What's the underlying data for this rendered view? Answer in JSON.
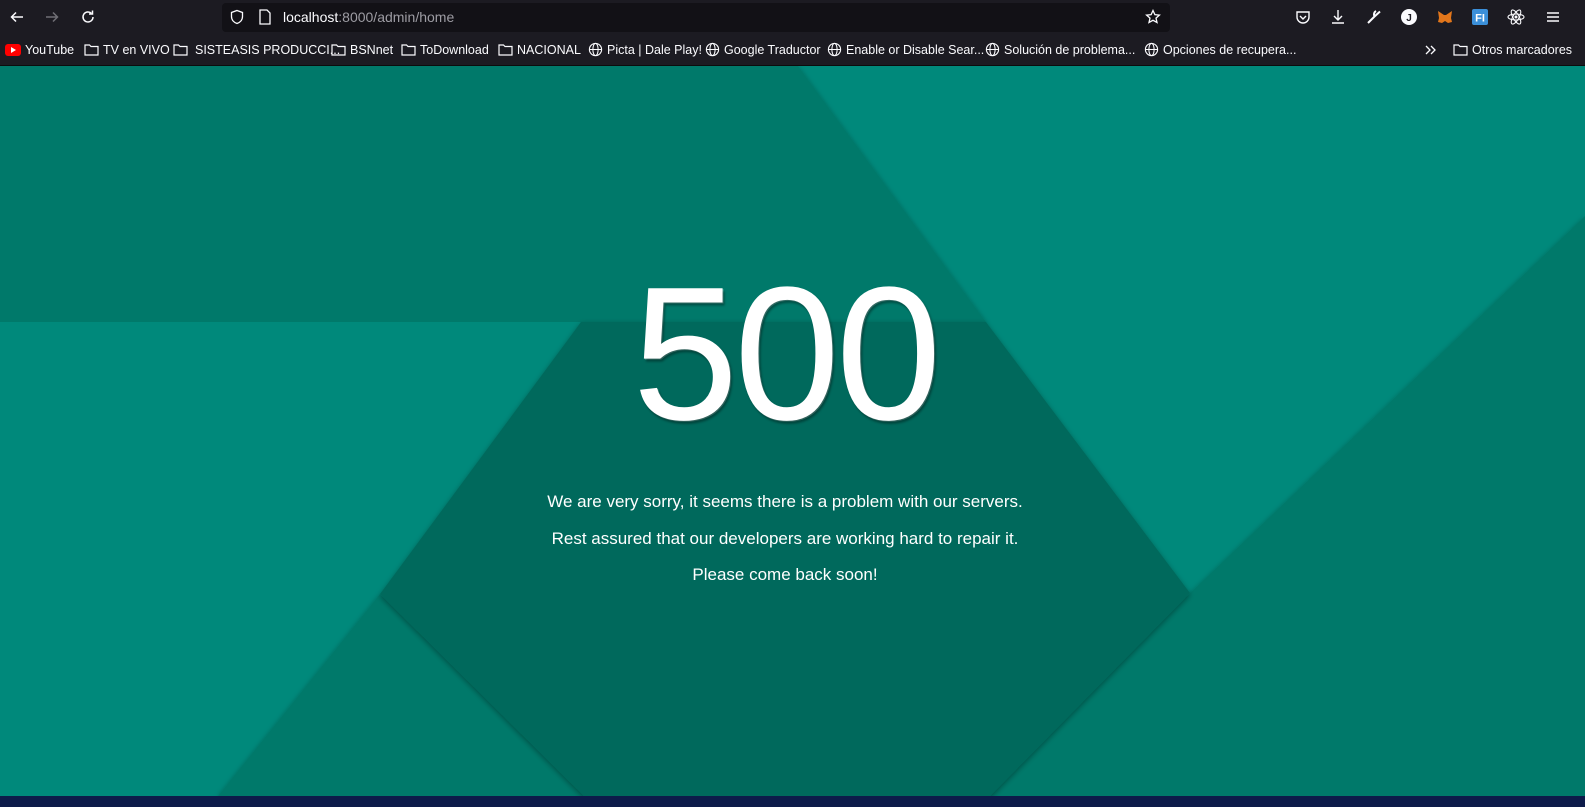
{
  "browser": {
    "url_host": "localhost",
    "url_rest": ":8000/admin/home",
    "icons": [
      "back-icon",
      "forward-icon",
      "reload-icon",
      "shield-icon",
      "page-icon",
      "star-icon",
      "pocket-icon",
      "download-icon",
      "wrench-icon",
      "account-icon",
      "metamask-icon",
      "extension-fi-icon",
      "react-icon",
      "menu-icon"
    ]
  },
  "bookmarks": {
    "items": [
      {
        "label": "YouTube",
        "icon": "youtube-icon"
      },
      {
        "label": "TV en VIVO",
        "icon": "folder-icon"
      },
      {
        "label": "SISTEASIS PRODUCCI...",
        "icon": "folder-icon"
      },
      {
        "label": "BSNnet",
        "icon": "folder-icon"
      },
      {
        "label": "ToDownload",
        "icon": "folder-icon"
      },
      {
        "label": "NACIONAL",
        "icon": "folder-icon"
      },
      {
        "label": "Picta | Dale Play!",
        "icon": "globe-icon"
      },
      {
        "label": "Google Traductor",
        "icon": "globe-icon"
      },
      {
        "label": "Enable or Disable Sear...",
        "icon": "globe-icon"
      },
      {
        "label": "Solución de problema...",
        "icon": "globe-icon"
      },
      {
        "label": "Opciones de recupera...",
        "icon": "globe-icon"
      }
    ],
    "other": "Otros marcadores"
  },
  "error": {
    "code": "500",
    "line1": "We are very sorry, it seems there is a problem with our servers.",
    "line2": "Rest assured that our developers are working hard to repair it.",
    "line3": "Please come back soon!"
  },
  "colors": {
    "bg_light": "#00897b",
    "bg_mid": "#00796b",
    "bg_dark": "#00695c"
  }
}
